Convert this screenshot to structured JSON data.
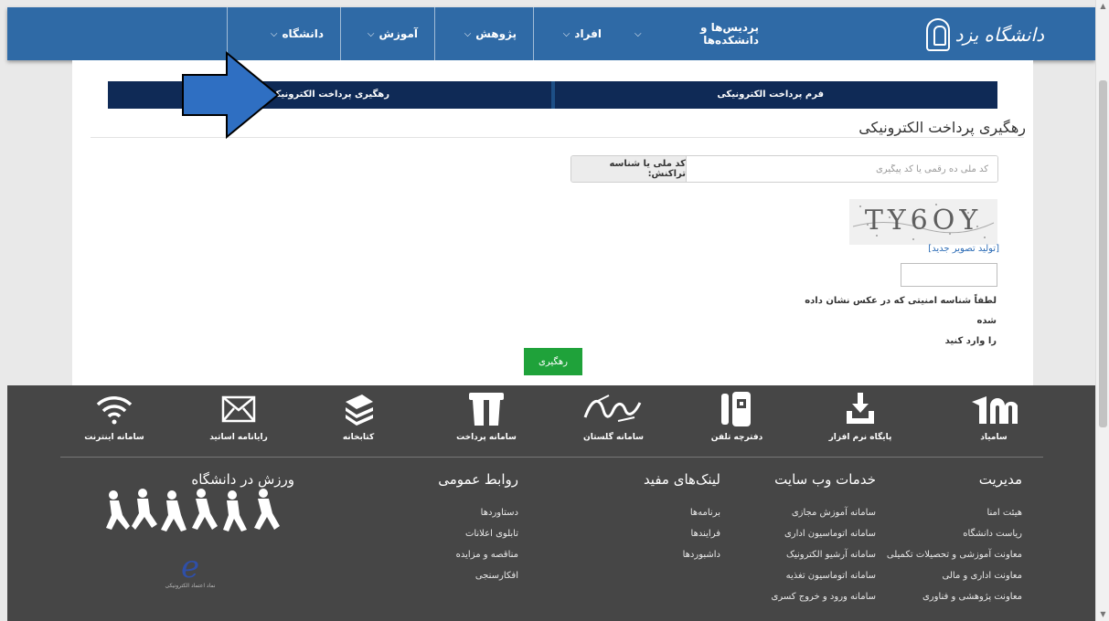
{
  "header": {
    "logo_text": "دانشگاه یزد",
    "nav": [
      {
        "label": "دانشگاه"
      },
      {
        "label": "آموزش"
      },
      {
        "label": "پژوهش"
      },
      {
        "label": "افراد"
      },
      {
        "label": "پردیس‌ها و دانشکده‌ها"
      }
    ]
  },
  "tabs": {
    "payment_form": "فرم پرداخت الکترونیکی",
    "payment_tracking": "رهگیری پرداخت الکترونیکی"
  },
  "page": {
    "title": "رهگیری پرداخت الکترونیکی",
    "field_label": "کد ملی یا شناسه تراکنش:",
    "field_placeholder": "کد ملی ده رقمی یا کد پیگیری",
    "captcha_text": "TY6OY",
    "regenerate_link": "[تولید تصویر جدید]",
    "captcha_hint_line1": "لطفاً شناسه امنیتی که در عکس نشان داده شده",
    "captcha_hint_line2": "را وارد کنید",
    "submit_label": "رهگیری"
  },
  "footer": {
    "icons": [
      {
        "label": "سامیاد",
        "icon": "samyad-icon"
      },
      {
        "label": "پایگاه نرم افزار",
        "icon": "download-icon"
      },
      {
        "label": "دفترچه تلفن",
        "icon": "phonebook-icon"
      },
      {
        "label": "سامانه گلستان",
        "icon": "golestan-icon"
      },
      {
        "label": "سامانه پرداخت",
        "icon": "payment-icon"
      },
      {
        "label": "کتابخانه",
        "icon": "books-icon"
      },
      {
        "label": "رایانامه اساتید",
        "icon": "mail-icon"
      },
      {
        "label": "سامانه اینترنت",
        "icon": "wifi-icon"
      }
    ],
    "columns": {
      "management": {
        "title": "مدیریت",
        "items": [
          "هیئت امنا",
          "ریاست دانشگاه",
          "معاونت آموزشی و تحصیلات تکمیلی",
          "معاونت اداری و مالی",
          "معاونت پژوهشی و فناوری"
        ]
      },
      "web_services": {
        "title": "خدمات وب سایت",
        "items": [
          "سامانه آموزش مجازی",
          "سامانه اتوماسیون اداری",
          "سامانه آرشیو الکترونیک",
          "سامانه اتوماسیون تغذیه",
          "سامانه ورود و خروج کسری"
        ]
      },
      "useful_links": {
        "title": "لینک‌های مفید",
        "items": [
          "برنامه‌ها",
          "فرایندها",
          "داشبوردها"
        ]
      },
      "public_relations": {
        "title": "روابط عمومی",
        "items": [
          "دستاوردها",
          "تابلوی اعلانات",
          "مناقصه و مزایده",
          "افکارسنجی"
        ]
      },
      "sports": {
        "title": "ورزش در دانشگاه"
      }
    },
    "enamad_caption": "نماد اعتماد الکترونیکی"
  }
}
